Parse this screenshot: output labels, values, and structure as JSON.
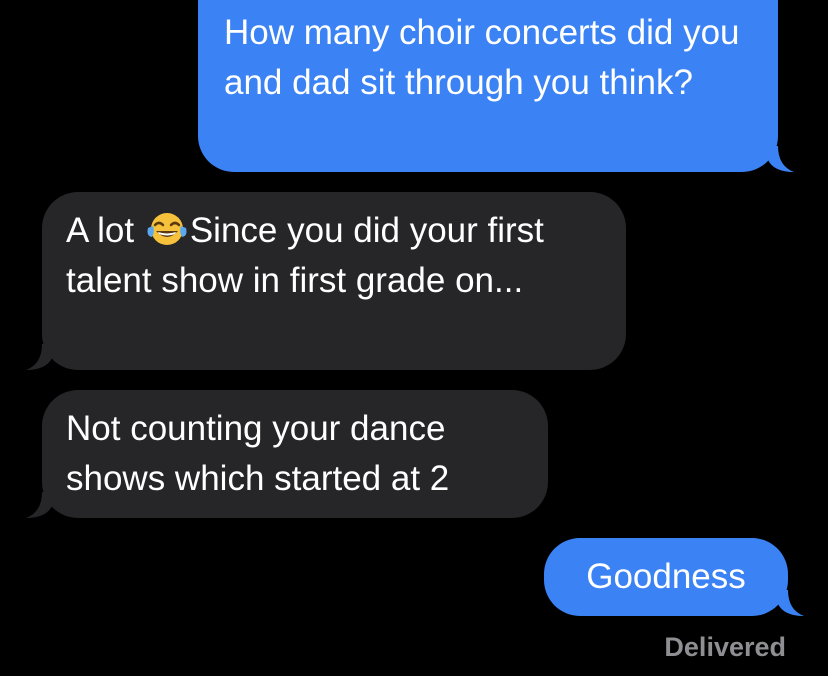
{
  "messages": [
    {
      "direction": "sent",
      "text": "How many choir concerts did you and dad sit through you think?"
    },
    {
      "direction": "received",
      "text_before_emoji": "A lot ",
      "emoji": "face-with-tears-of-joy",
      "text_after_emoji": "Since you did your first talent show in first grade on..."
    },
    {
      "direction": "received",
      "text": "Not counting your dance shows which started at 2"
    },
    {
      "direction": "sent",
      "text": "Goodness"
    }
  ],
  "status": {
    "delivered_label": "Delivered"
  },
  "colors": {
    "background": "#000000",
    "sent_bubble": "#3b83f5",
    "received_bubble": "#262628",
    "status_text": "#8e8e93"
  }
}
